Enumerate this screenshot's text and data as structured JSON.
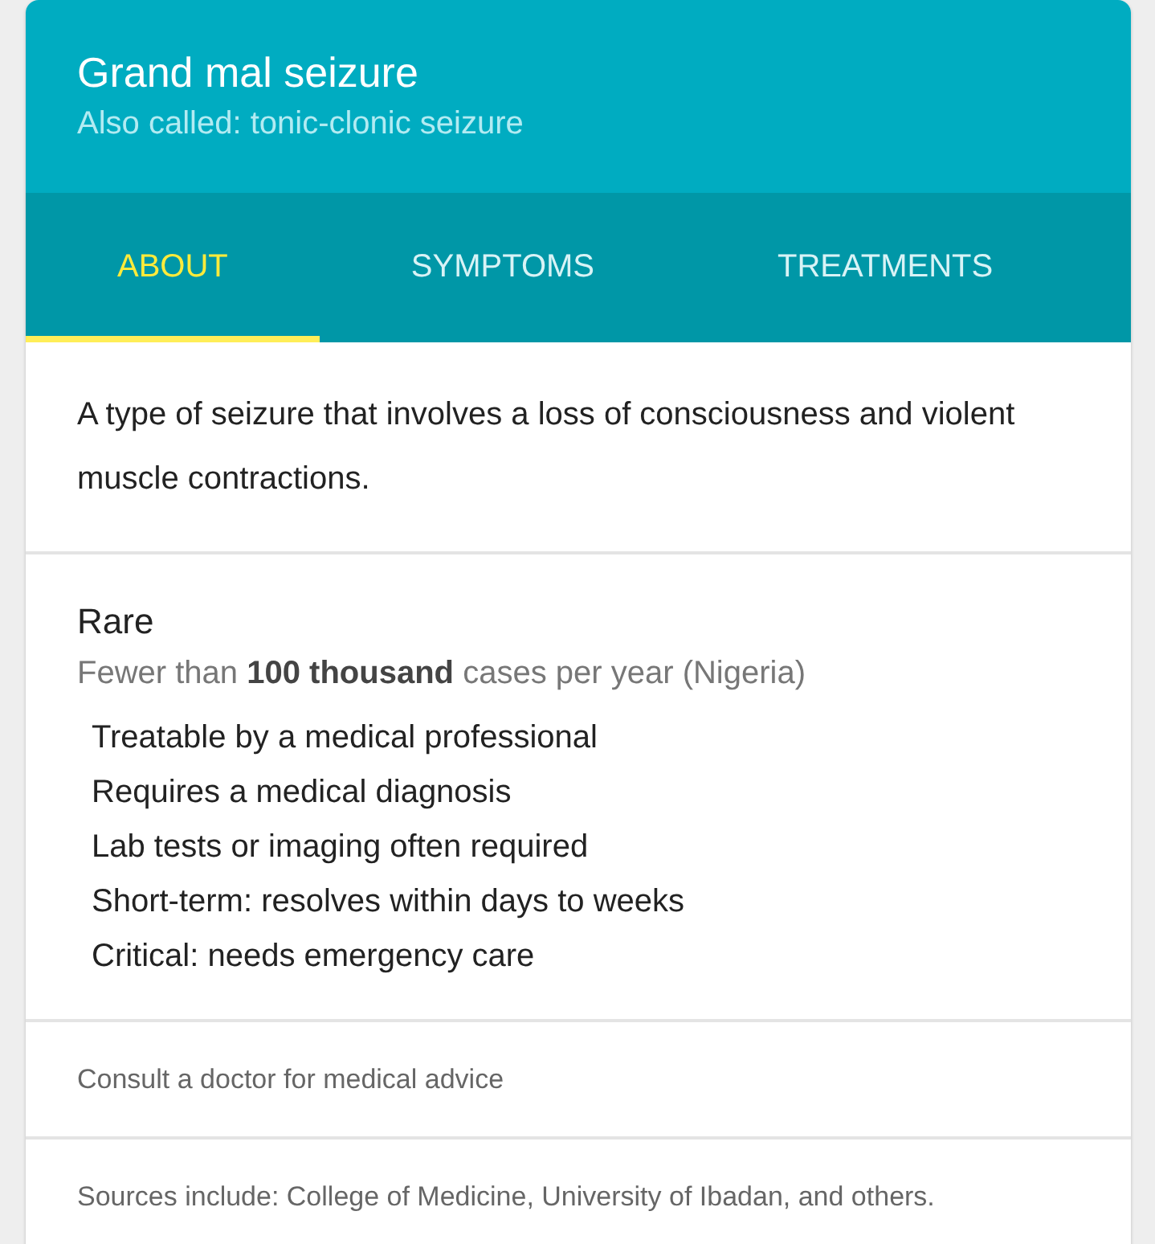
{
  "header": {
    "title": "Grand mal seizure",
    "subtitle": "Also called: tonic-clonic seizure"
  },
  "tabs": [
    {
      "label": "ABOUT",
      "selected": true
    },
    {
      "label": "SYMPTOMS",
      "selected": false
    },
    {
      "label": "TREATMENTS",
      "selected": false
    }
  ],
  "description": "A type of seizure that involves a loss of consciousness and violent muscle contractions.",
  "prevalence": {
    "heading": "Rare",
    "detail": "Fewer than **100 thousand** cases per year (Nigeria)"
  },
  "facts": [
    "Treatable by a medical professional",
    "Requires a medical diagnosis",
    "Lab tests or imaging often required",
    "Short-term: resolves within days to weeks",
    "Critical: needs emergency care"
  ],
  "disclaimer": "Consult a doctor for medical advice",
  "sources": "Sources include: College of Medicine, University of Ibadan, and others."
}
